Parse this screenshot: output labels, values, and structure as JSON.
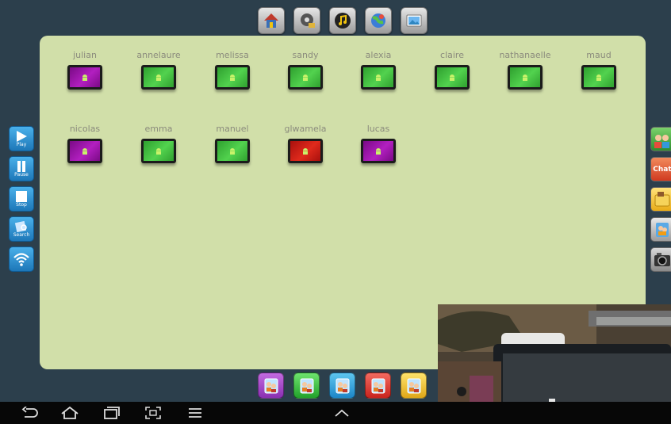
{
  "top_toolbar": [
    {
      "icon": "home-icon"
    },
    {
      "icon": "film-icon"
    },
    {
      "icon": "music-icon"
    },
    {
      "icon": "globe-icon"
    },
    {
      "icon": "photo-icon"
    }
  ],
  "students": [
    {
      "name": "julian",
      "status": "purple"
    },
    {
      "name": "annelaure",
      "status": "green"
    },
    {
      "name": "melissa",
      "status": "green"
    },
    {
      "name": "sandy",
      "status": "green"
    },
    {
      "name": "alexia",
      "status": "green"
    },
    {
      "name": "claire",
      "status": "green"
    },
    {
      "name": "nathanaelle",
      "status": "green"
    },
    {
      "name": "maud",
      "status": "green"
    },
    {
      "name": "nicolas",
      "status": "purple"
    },
    {
      "name": "emma",
      "status": "green"
    },
    {
      "name": "manuel",
      "status": "green"
    },
    {
      "name": "glwamela",
      "status": "red"
    },
    {
      "name": "lucas",
      "status": "purple"
    }
  ],
  "left_sidebar": {
    "play": "Play",
    "pause": "Pause",
    "stop": "Stop",
    "search": "Search",
    "wifi_icon": "wifi-icon"
  },
  "right_sidebar": {
    "groups_icon": "students-group-icon",
    "chat": "Chat",
    "file_icon": "file-icon",
    "users_icon": "users-icon",
    "camera_icon": "camera-icon"
  },
  "groups": [
    {
      "color": "purple"
    },
    {
      "color": "green"
    },
    {
      "color": "blue"
    },
    {
      "color": "red"
    },
    {
      "color": "yellow"
    }
  ],
  "colors": {
    "panel": "#d1dfa9",
    "background": "#2c3f4c",
    "tablet_green": "#3cbf3a",
    "tablet_purple": "#9a16a8",
    "tablet_red": "#d0221a"
  }
}
